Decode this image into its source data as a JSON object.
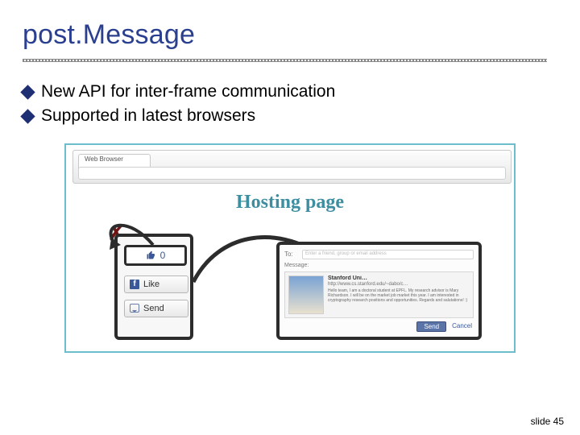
{
  "title": "post.Message",
  "bullets": [
    "New API for inter-frame communication",
    "Supported in latest browsers"
  ],
  "illus": {
    "browser_tab": "Web Browser",
    "hosting_label": "Hosting page",
    "like_count": "0",
    "like_label": "Like",
    "send_label": "Send",
    "cross1": "✗",
    "cross2": "✗",
    "dialog": {
      "to_label": "To:",
      "to_placeholder": "Enter a friend, group or email address",
      "message_label": "Message:",
      "share_site": "Stanford Uni…",
      "share_url": "http://www.cs.stanford.edu/~dabo/c…",
      "share_blurb": "Hello team, I am a doctoral student at EPFL. My research advisor is Mary Richardson. I will be on the market job market this year. I am interested in cryptography research positions and opportunities. Regards and salutations! :)",
      "send_btn": "Send",
      "cancel_btn": "Cancel"
    }
  },
  "footer": "slide 45"
}
